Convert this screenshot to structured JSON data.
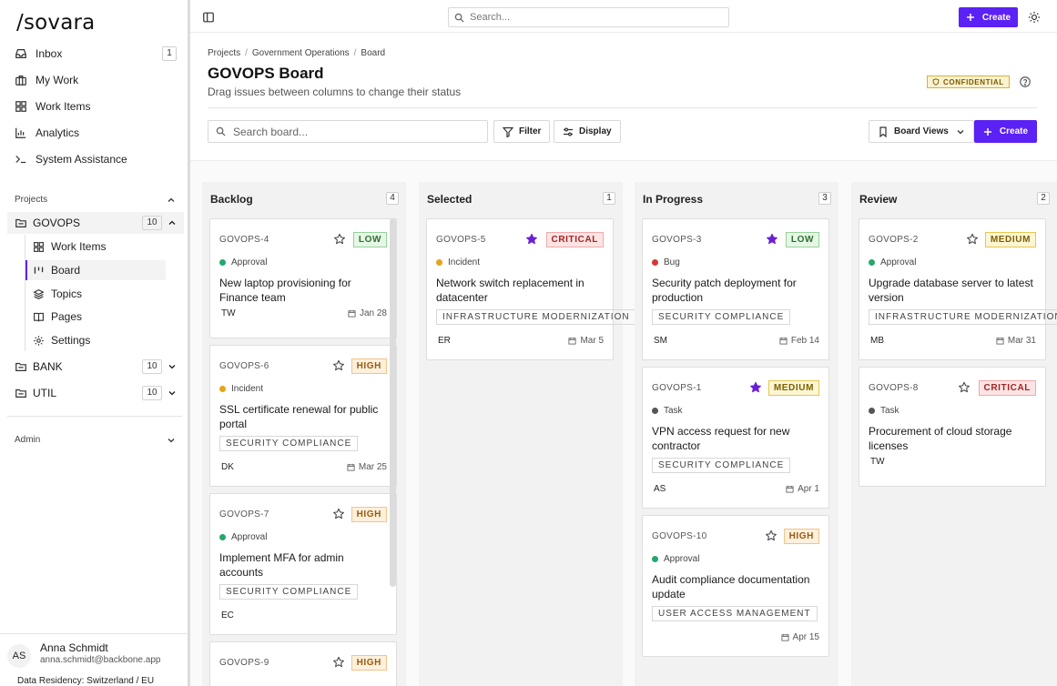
{
  "app": {
    "logo": "/sovara"
  },
  "sidebar": {
    "nav": [
      {
        "label": "Inbox",
        "icon": "inbox-icon",
        "count": "1"
      },
      {
        "label": "My Work",
        "icon": "briefcase-icon"
      },
      {
        "label": "Work Items",
        "icon": "grid-icon"
      },
      {
        "label": "Analytics",
        "icon": "bar-chart-icon"
      },
      {
        "label": "System Assistance",
        "icon": "terminal-icon"
      }
    ],
    "projects_label": "Projects",
    "projects": [
      {
        "name": "GOVOPS",
        "count": "10"
      },
      {
        "name": "BANK",
        "count": "10"
      },
      {
        "name": "UTIL",
        "count": "10"
      }
    ],
    "govops_items": [
      {
        "label": "Work Items",
        "icon": "grid-icon"
      },
      {
        "label": "Board",
        "icon": "kanban-icon"
      },
      {
        "label": "Topics",
        "icon": "layers-icon"
      },
      {
        "label": "Pages",
        "icon": "book-icon"
      },
      {
        "label": "Settings",
        "icon": "gear-icon"
      }
    ],
    "admin_label": "Admin",
    "user": {
      "initials": "AS",
      "name": "Anna Schmidt",
      "email": "anna.schmidt@backbone.app"
    },
    "residency": "Data Residency: Switzerland / EU"
  },
  "topbar": {
    "search_placeholder": "Search...",
    "create_label": "Create"
  },
  "header": {
    "breadcrumb": [
      "Projects",
      "Government Operations",
      "Board"
    ],
    "title": "GOVOPS Board",
    "subtitle": "Drag issues between columns to change their status",
    "badge": "CONFIDENTIAL"
  },
  "toolbar": {
    "search_placeholder": "Search board...",
    "filter_label": "Filter",
    "display_label": "Display",
    "views_label": "Board Views",
    "create_label": "Create"
  },
  "colors": {
    "accent": "#5b21f5",
    "star_filled": "#6a1fd6",
    "type_approval": "#22a86b",
    "type_incident": "#e8a317",
    "type_bug": "#d93636",
    "type_task": "#555555"
  },
  "columns": [
    {
      "name": "Backlog",
      "count": "4",
      "cards": [
        {
          "id": "GOVOPS-4",
          "starred": false,
          "priority": "LOW",
          "type": "Approval",
          "title": "New laptop provisioning for Finance team",
          "tag": "",
          "assignee": "TW",
          "due": "Jan 28"
        },
        {
          "id": "GOVOPS-6",
          "starred": false,
          "priority": "HIGH",
          "type": "Incident",
          "title": "SSL certificate renewal for public portal",
          "tag": "SECURITY COMPLIANCE",
          "assignee": "DK",
          "due": "Mar 25"
        },
        {
          "id": "GOVOPS-7",
          "starred": false,
          "priority": "HIGH",
          "type": "Approval",
          "title": "Implement MFA for admin accounts",
          "tag": "SECURITY COMPLIANCE",
          "assignee": "EC",
          "due": ""
        },
        {
          "id": "GOVOPS-9",
          "starred": false,
          "priority": "HIGH",
          "type": "",
          "title": "",
          "tag": "",
          "assignee": "",
          "due": ""
        }
      ]
    },
    {
      "name": "Selected",
      "count": "1",
      "cards": [
        {
          "id": "GOVOPS-5",
          "starred": true,
          "priority": "CRITICAL",
          "type": "Incident",
          "title": "Network switch replacement in datacenter",
          "tag": "INFRASTRUCTURE MODERNIZATION",
          "assignee": "ER",
          "due": "Mar 5"
        }
      ]
    },
    {
      "name": "In Progress",
      "count": "3",
      "cards": [
        {
          "id": "GOVOPS-3",
          "starred": true,
          "priority": "LOW",
          "type": "Bug",
          "title": "Security patch deployment for production",
          "tag": "SECURITY COMPLIANCE",
          "assignee": "SM",
          "due": "Feb 14"
        },
        {
          "id": "GOVOPS-1",
          "starred": true,
          "priority": "MEDIUM",
          "type": "Task",
          "title": "VPN access request for new contractor",
          "tag": "SECURITY COMPLIANCE",
          "assignee": "AS",
          "due": "Apr 1"
        },
        {
          "id": "GOVOPS-10",
          "starred": false,
          "priority": "HIGH",
          "type": "Approval",
          "title": "Audit compliance documentation update",
          "tag": "USER ACCESS MANAGEMENT",
          "assignee": "",
          "due": "Apr 15"
        }
      ]
    },
    {
      "name": "Review",
      "count": "2",
      "cards": [
        {
          "id": "GOVOPS-2",
          "starred": false,
          "priority": "MEDIUM",
          "type": "Approval",
          "title": "Upgrade database server to latest version",
          "tag": "INFRASTRUCTURE MODERNIZATION",
          "assignee": "MB",
          "due": "Mar 31"
        },
        {
          "id": "GOVOPS-8",
          "starred": false,
          "priority": "CRITICAL",
          "type": "Task",
          "title": "Procurement of cloud storage licenses",
          "tag": "",
          "assignee": "TW",
          "due": ""
        }
      ]
    }
  ]
}
